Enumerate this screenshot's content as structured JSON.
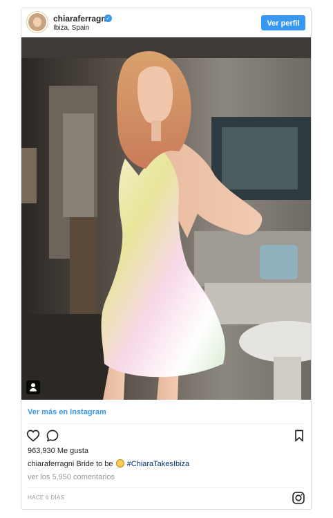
{
  "header": {
    "username": "chiaraferragni",
    "verified_icon": "verified-badge-icon",
    "location": "Ibiza, Spain",
    "profile_button": "Ver perfil"
  },
  "post": {
    "view_more": "Ver más en Instagram",
    "likes": "963,930 Me gusta",
    "caption_user": "chiaraferragni",
    "caption_text": "Bride to be",
    "caption_emoji": "emoji-icon",
    "caption_hashtag": "#ChiaraTakesIbiza",
    "comments_link": "ver los 5,950 comentarios",
    "date": "HACE 6 DÍAS"
  },
  "icons": {
    "like": "heart-icon",
    "comment": "comment-icon",
    "save": "bookmark-icon",
    "brand": "instagram-icon",
    "user_tag": "user-tag-icon"
  },
  "colors": {
    "accent": "#3897f0",
    "hashtag": "#003569",
    "muted": "#999999"
  }
}
